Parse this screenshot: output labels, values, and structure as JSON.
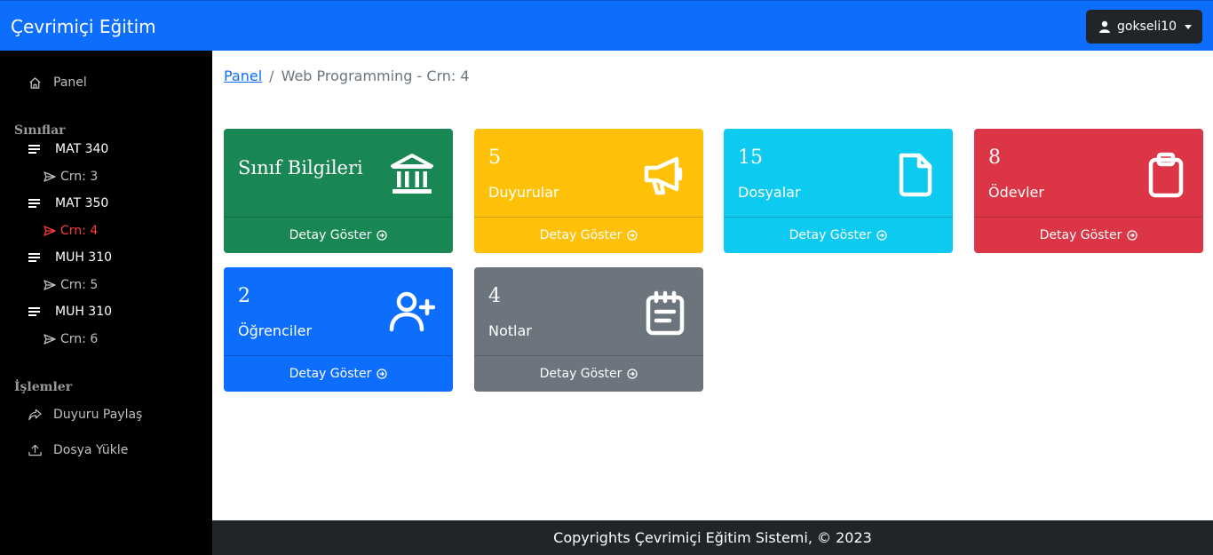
{
  "app": {
    "brand": "Çevrimiçi Eğitim"
  },
  "user": {
    "name": "gokseli10",
    "icon": "user-icon"
  },
  "sidebar": {
    "panel": "Panel",
    "classes_heading": "Sınıflar",
    "classes": [
      {
        "name": "MAT 340",
        "crn": "Crn: 3",
        "active": false
      },
      {
        "name": "MAT 350",
        "crn": "Crn: 4",
        "active": true
      },
      {
        "name": "MUH 310",
        "crn": "Crn: 5",
        "active": false
      },
      {
        "name": "MUH 310",
        "crn": "Crn: 6",
        "active": false
      }
    ],
    "actions_heading": "İşlemler",
    "share_announcement": "Duyuru Paylaş",
    "upload_file": "Dosya Yükle"
  },
  "breadcrumb": {
    "home": "Panel",
    "separator": "/",
    "current": "Web Programming - Crn: 4"
  },
  "cards": [
    {
      "title": "Sınıf Bilgileri",
      "footer": "Detay Göster",
      "color": "#198754",
      "icon": "bank-icon"
    },
    {
      "count": "5",
      "label": "Duyurular",
      "footer": "Detay Göster",
      "color": "#ffc107",
      "icon": "megaphone-icon"
    },
    {
      "count": "15",
      "label": "Dosyalar",
      "footer": "Detay Göster",
      "color": "#0dcaf0",
      "icon": "file-icon"
    },
    {
      "count": "8",
      "label": "Ödevler",
      "footer": "Detay Göster",
      "color": "#dc3545",
      "icon": "clipboard-icon"
    },
    {
      "count": "2",
      "label": "Öğrenciler",
      "footer": "Detay Göster",
      "color": "#0d6efd",
      "icon": "user-plus-icon"
    },
    {
      "count": "4",
      "label": "Notlar",
      "footer": "Detay Göster",
      "color": "#6c757d",
      "icon": "notepad-icon"
    }
  ],
  "footer": {
    "text": "Copyrights Çevrimiçi Eğitim Sistemi, © 2023"
  }
}
